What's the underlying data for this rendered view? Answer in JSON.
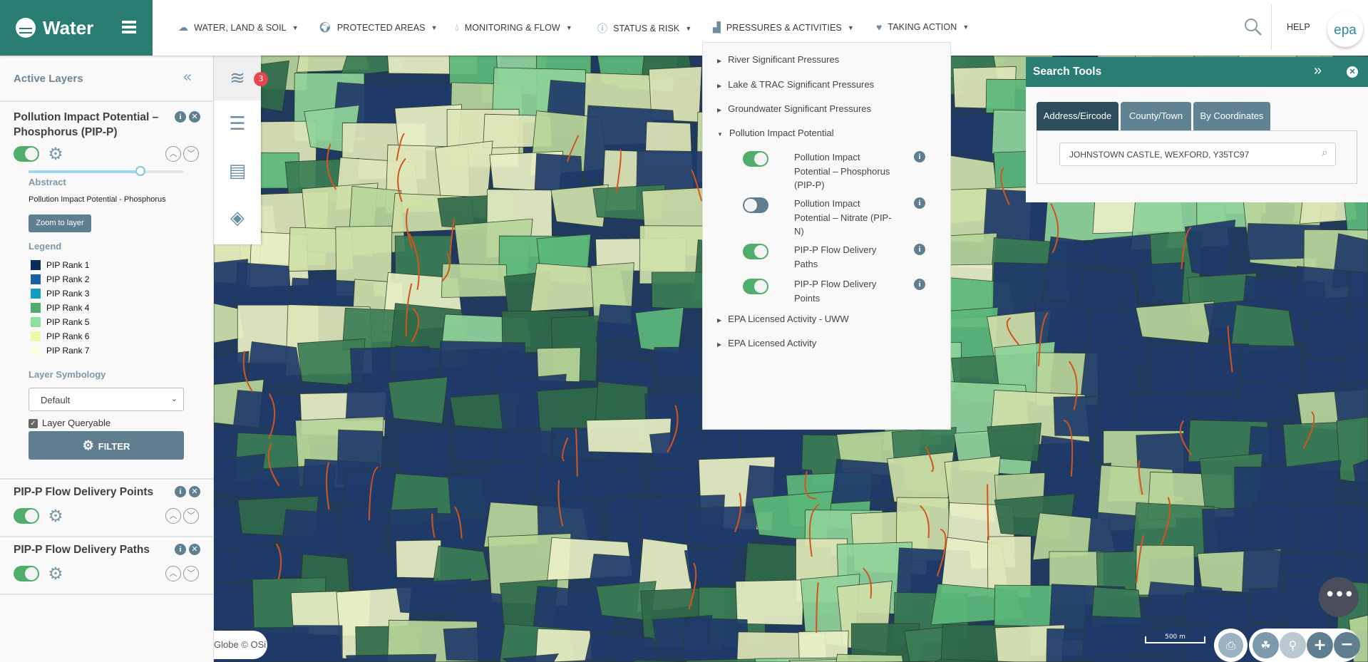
{
  "app": {
    "title": "Water"
  },
  "nav": [
    {
      "label": "WATER, LAND & SOIL",
      "icon": "landscape-icon"
    },
    {
      "label": "PROTECTED AREAS",
      "icon": "globe-hand-icon"
    },
    {
      "label": "MONITORING & FLOW",
      "icon": "water-drop-icon"
    },
    {
      "label": "STATUS & RISK",
      "icon": "info-icon"
    },
    {
      "label": "PRESSURES & ACTIVITIES",
      "icon": "factory-icon"
    },
    {
      "label": "TAKING ACTION",
      "icon": "heart-icon"
    }
  ],
  "header": {
    "help": "HELP",
    "logo": "epa"
  },
  "active_layers": {
    "title": "Active Layers",
    "layers": [
      {
        "title": "Pollution Impact Potential – Phosphorus (PIP-P)",
        "enabled": true,
        "opacity": 0.72,
        "abstract_heading": "Abstract",
        "abstract": "Pollution Impact Potential - Phosphorus",
        "zoom_button": "Zoom to layer",
        "legend_heading": "Legend",
        "legend": [
          {
            "label": "PIP Rank 1",
            "color": "#0c2a5a"
          },
          {
            "label": "PIP Rank 2",
            "color": "#1b5ea8"
          },
          {
            "label": "PIP Rank 3",
            "color": "#139cc0"
          },
          {
            "label": "PIP Rank 4",
            "color": "#4fae6e"
          },
          {
            "label": "PIP Rank 5",
            "color": "#8fe0a0"
          },
          {
            "label": "PIP Rank 6",
            "color": "#eef8a8"
          },
          {
            "label": "PIP Rank 7",
            "color": "#fbfde0"
          }
        ],
        "symbology_heading": "Layer Symbology",
        "symbology": "Default",
        "queryable_label": "Layer Queryable",
        "queryable": true,
        "filter_button": "FILTER"
      },
      {
        "title": "PIP-P Flow Delivery Points",
        "enabled": true
      },
      {
        "title": "PIP-P Flow Delivery Paths",
        "enabled": true
      }
    ]
  },
  "tool_strip": {
    "badge": "3"
  },
  "dropdown": {
    "items": [
      "River Significant Pressures",
      "Lake & TRAC Significant Pressures",
      "Groundwater Significant Pressures",
      "Pollution Impact Potential",
      "EPA Licensed Activity - UWW",
      "EPA Licensed Activity"
    ],
    "sub": [
      {
        "label": "Pollution Impact Potential – Phosphorus (PIP-P)",
        "enabled": true
      },
      {
        "label": "Pollution Impact Potential – Nitrate (PIP-N)",
        "enabled": false
      },
      {
        "label": "PIP-P Flow Delivery Paths",
        "enabled": true
      },
      {
        "label": "PIP-P Flow Delivery Points",
        "enabled": true
      }
    ]
  },
  "search_tools": {
    "title": "Search Tools",
    "tabs": [
      "Address/Eircode",
      "County/Town",
      "By Coordinates"
    ],
    "active_tab": "Address/Eircode",
    "value": "JOHNSTOWN CASTLE, WEXFORD, Y35TC97"
  },
  "map": {
    "attribution": "Globe © OSi",
    "scale": "500 m"
  }
}
